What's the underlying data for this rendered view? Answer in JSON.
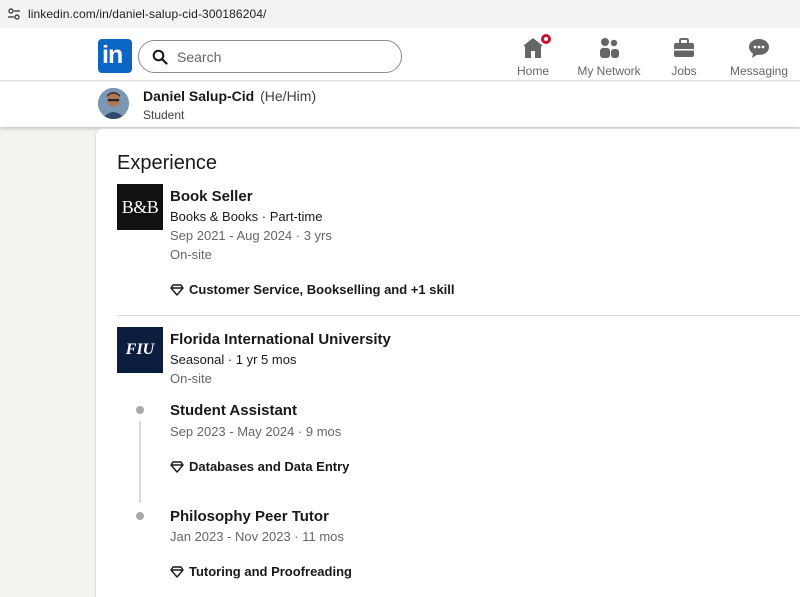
{
  "browser": {
    "url": "linkedin.com/in/daniel-salup-cid-300186204/"
  },
  "nav": {
    "logo": "in",
    "search_placeholder": "Search",
    "items": [
      {
        "label": "Home",
        "icon": "home-icon"
      },
      {
        "label": "My Network",
        "icon": "network-icon"
      },
      {
        "label": "Jobs",
        "icon": "briefcase-icon"
      },
      {
        "label": "Messaging",
        "icon": "messaging-icon"
      }
    ]
  },
  "profile": {
    "name": "Daniel Salup-Cid",
    "pronouns": "(He/Him)",
    "headline": "Student"
  },
  "experience": {
    "title": "Experience",
    "entries": [
      {
        "logo_text": "B&B",
        "role": "Book Seller",
        "company_line": "Books & Books · Part-time",
        "dates": "Sep 2021 - Aug 2024 · 3 yrs",
        "location": "On-site",
        "skills": "Customer Service, Bookselling and +1 skill"
      },
      {
        "logo_text": "FIU",
        "company": "Florida International University",
        "type_line": "Seasonal · 1 yr 5 mos",
        "location": "On-site",
        "positions": [
          {
            "role": "Student Assistant",
            "dates": "Sep 2023 - May 2024 · 9 mos",
            "skills": "Databases and Data Entry"
          },
          {
            "role": "Philosophy Peer Tutor",
            "dates": "Jan 2023 - Nov 2023 · 11 mos",
            "skills": "Tutoring and Proofreading"
          }
        ]
      }
    ]
  },
  "colors": {
    "brand": "#0a66c2",
    "badge": "#cb112d",
    "page_bg": "#f4f2ee"
  }
}
